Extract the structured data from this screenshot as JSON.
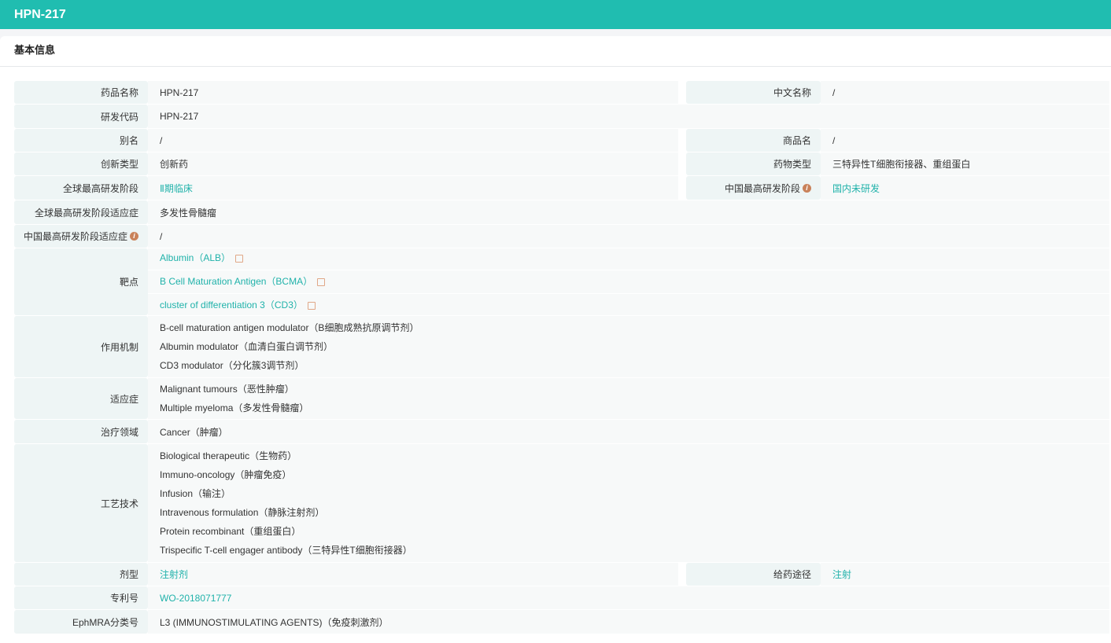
{
  "header": {
    "title": "HPN-217"
  },
  "section": {
    "title": "基本信息"
  },
  "fields": {
    "drug_name": {
      "label": "药品名称",
      "value": "HPN-217"
    },
    "chinese_name": {
      "label": "中文名称",
      "value": "/"
    },
    "dev_code": {
      "label": "研发代码",
      "value": "HPN-217"
    },
    "alias": {
      "label": "别名",
      "value": "/"
    },
    "trade_name": {
      "label": "商品名",
      "value": "/"
    },
    "innovation_type": {
      "label": "创新类型",
      "value": "创新药"
    },
    "drug_type": {
      "label": "药物类型",
      "value": "三特异性T细胞衔接器、重组蛋白"
    },
    "global_stage": {
      "label": "全球最高研发阶段",
      "value": "Ⅱ期临床"
    },
    "china_stage": {
      "label": "中国最高研发阶段",
      "value": "国内未研发"
    },
    "global_indication": {
      "label": "全球最高研发阶段适应症",
      "value": "多发性骨髓瘤"
    },
    "china_indication": {
      "label": "中国最高研发阶段适应症",
      "value": "/"
    },
    "targets": {
      "label": "靶点",
      "items": [
        "Albumin（ALB）",
        "B Cell Maturation Antigen（BCMA）",
        "cluster of differentiation 3（CD3）"
      ]
    },
    "mechanism": {
      "label": "作用机制",
      "items": [
        "B-cell maturation antigen modulator（B细胞成熟抗原调节剂）",
        "Albumin modulator（血清白蛋白调节剂）",
        "CD3 modulator（分化簇3调节剂）"
      ]
    },
    "indications": {
      "label": "适应症",
      "items": [
        "Malignant tumours（恶性肿瘤）",
        "Multiple myeloma（多发性骨髓瘤）"
      ]
    },
    "therapeutic_area": {
      "label": "治疗领域",
      "value": "Cancer（肿瘤）"
    },
    "technology": {
      "label": "工艺技术",
      "items": [
        "Biological therapeutic（生物药）",
        "Immuno-oncology（肿瘤免疫）",
        "Infusion（输注）",
        "Intravenous formulation（静脉注射剂）",
        "Protein recombinant（重组蛋白）",
        "Trispecific T-cell engager antibody（三特异性T细胞衔接器）"
      ]
    },
    "dosage_form": {
      "label": "剂型",
      "value": "注射剂"
    },
    "route": {
      "label": "给药途径",
      "value": "注射"
    },
    "patent": {
      "label": "专利号",
      "value": "WO-2018071777"
    },
    "ephmra": {
      "label": "EphMRA分类号",
      "value": "L3 (IMMUNOSTIMULATING AGENTS)（免疫刺激剂）"
    }
  },
  "colors": {
    "brand": "#20bdb0",
    "link": "#20b2aa",
    "info": "#c9825a"
  }
}
